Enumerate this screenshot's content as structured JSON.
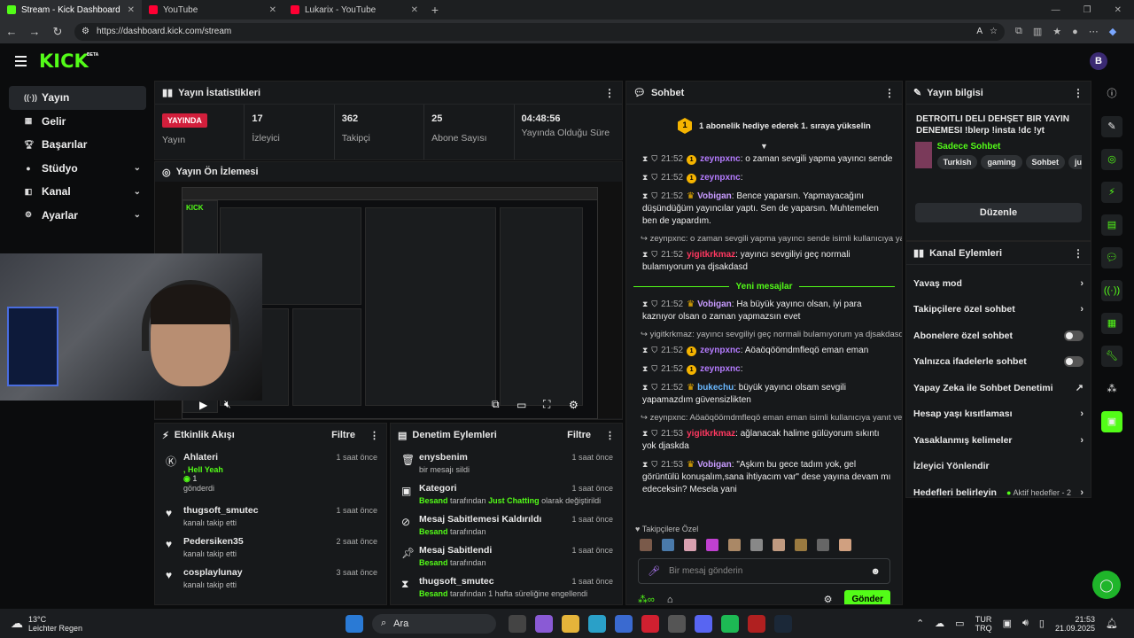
{
  "browser": {
    "tabs": [
      {
        "title": "Stream - Kick Dashboard",
        "color": "#53fc18"
      },
      {
        "title": "YouTube",
        "color": "#ff0033"
      },
      {
        "title": "Lukarix - YouTube",
        "color": "#ff0033"
      }
    ],
    "url": "https://dashboard.kick.com/stream"
  },
  "brand": {
    "logo": "KICK",
    "beta": "BETA",
    "accent": "#53fc18",
    "user_initial": "B"
  },
  "sidebar": {
    "items": [
      {
        "label": "Yayın",
        "icon": "broadcast-icon"
      },
      {
        "label": "Gelir",
        "icon": "chart-icon"
      },
      {
        "label": "Başarılar",
        "icon": "trophy-icon"
      },
      {
        "label": "Stüdyo",
        "icon": "studio-icon"
      },
      {
        "label": "Kanal",
        "icon": "channel-icon"
      },
      {
        "label": "Ayarlar",
        "icon": "gear-icon"
      }
    ]
  },
  "stats": {
    "title": "Yayın İstatistikleri",
    "live_badge": "YAYINDA",
    "live_label": "Yayın",
    "items": [
      {
        "value": "17",
        "label": "İzleyici"
      },
      {
        "value": "362",
        "label": "Takipçi"
      },
      {
        "value": "25",
        "label": "Abone Sayısı"
      },
      {
        "value": "04:48:56",
        "label": "Yayında Olduğu Süre"
      }
    ]
  },
  "preview": {
    "title": "Yayın Ön İzlemesi"
  },
  "activity": {
    "title": "Etkinlik Akışı",
    "filter": "Filtre",
    "items": [
      {
        "name": "Ahlateri",
        "line1": ", Hell Yeah",
        "line2": "1",
        "line3": "gönderdi",
        "time": "1 saat önce"
      },
      {
        "name": "thugsoft_smutec",
        "sub": "kanalı takip etti",
        "time": "1 saat önce"
      },
      {
        "name": "Pedersiken35",
        "sub": "kanalı takip etti",
        "time": "2 saat önce"
      },
      {
        "name": "cosplaylunay",
        "sub": "kanalı takip etti",
        "time": "3 saat önce"
      }
    ]
  },
  "moderation": {
    "title": "Denetim Eylemleri",
    "filter": "Filtre",
    "items": [
      {
        "name": "enysbenim",
        "sub": "bir mesajı sildi",
        "time": "1 saat önce"
      },
      {
        "name": "Kategori",
        "actor": "Besand",
        "mid": "tarafından",
        "target": "Just Chatting",
        "tail": "olarak değiştirildi",
        "time": "1 saat önce"
      },
      {
        "name": "Mesaj Sabitlemesi Kaldırıldı",
        "actor": "Besand",
        "mid": "tarafından",
        "time": "1 saat önce"
      },
      {
        "name": "Mesaj Sabitlendi",
        "actor": "Besand",
        "mid": "tarafından",
        "time": "1 saat önce"
      },
      {
        "name": "thugsoft_smutec",
        "actor": "Besand",
        "mid": "tarafından 1 hafta süreliğine engellendi",
        "time": "1 saat önce"
      }
    ]
  },
  "chat": {
    "title": "Sohbet",
    "gift_banner": "1 abonelik hediye ederek 1. sıraya yükselin",
    "gift_rank": "1",
    "new_messages": "Yeni mesajlar",
    "messages": [
      {
        "time": "21:52",
        "badge": "1",
        "user": "zeynpxnc",
        "ucolor": "#b57cff",
        "text": "o zaman sevgili yapma yayıncı sende"
      },
      {
        "time": "21:52",
        "badge": "1",
        "user": "zeynpxnc",
        "ucolor": "#b57cff",
        "text": ""
      },
      {
        "time": "21:52",
        "badge": "crown",
        "user": "Vobigan",
        "ucolor": "#c89bff",
        "text": "Bence yaparsın. Yapmayacağını düşündüğüm yayıncılar yaptı. Sen de yaparsın. Muhtemelen ben de yapardım."
      },
      {
        "reply": "zeynpxnc: o zaman sevgili yapma yayıncı sende isimli kullanıcıya yanı..."
      },
      {
        "time": "21:52",
        "badge": "none",
        "user": "yigitkrkmaz",
        "ucolor": "#ff3860",
        "text": "yayıncı sevgiliyi geç normali bulamıyorum ya djsakdasd"
      },
      {
        "divider": true
      },
      {
        "time": "21:52",
        "badge": "crown",
        "user": "Vobigan",
        "ucolor": "#c89bff",
        "text": "Ha büyük yayıncı olsan, iyi para kaznıyor olsan o zaman yapmazsın evet"
      },
      {
        "reply": "yigitkrkmaz: yayıncı sevgiliyi geç normali bulamıyorum ya djsakdasd i..."
      },
      {
        "time": "21:52",
        "badge": "1",
        "user": "zeynpxnc",
        "ucolor": "#b57cff",
        "text": "Aöaöqöömdmfleqö eman eman"
      },
      {
        "time": "21:52",
        "badge": "1",
        "user": "zeynpxnc",
        "ucolor": "#b57cff",
        "text": ""
      },
      {
        "time": "21:52",
        "badge": "crown",
        "user": "bukechu",
        "ucolor": "#6ab8ff",
        "text": "büyük yayıncı olsam sevgili yapamazdım güvensizlikten"
      },
      {
        "reply": "zeynpxnc: Aöaöqöömdmfleqö eman eman isimli kullanıcıya yanıt ver..."
      },
      {
        "time": "21:53",
        "badge": "none",
        "user": "yigitkrkmaz",
        "ucolor": "#ff3860",
        "text": "ağlanacak halime gülüyorum sıkıntı yok djaskda"
      },
      {
        "time": "21:53",
        "badge": "crown",
        "user": "Vobigan",
        "ucolor": "#c89bff",
        "text": "\"Aşkım bu gece tadım yok, gel görüntülü konuşalım,sana ihtiyacım var\" dese yayına devam mı edeceksin? Mesela yani"
      }
    ],
    "followers_label": "Takipçilere Özel",
    "input_placeholder": "Bir mesaj gönderin",
    "send": "Gönder"
  },
  "info": {
    "title": "Yayın bilgisi",
    "stream_title": "DETROITLI DELI DEHŞET BIR YAYIN DENEMESI !blerp !insta !dc !yt",
    "category": "Sadece Sohbet",
    "tags": [
      "Turkish",
      "gaming",
      "Sohbet",
      "justch"
    ],
    "edit": "Düzenle"
  },
  "actions": {
    "title": "Kanal Eylemleri",
    "items": [
      {
        "label": "Yavaş mod",
        "kind": "chevron"
      },
      {
        "label": "Takipçilere özel sohbet",
        "kind": "chevron"
      },
      {
        "label": "Abonelere özel sohbet",
        "kind": "toggle"
      },
      {
        "label": "Yalnızca ifadelerle sohbet",
        "kind": "toggle"
      },
      {
        "label": "Yapay Zeka ile Sohbet Denetimi",
        "kind": "external"
      },
      {
        "label": "Hesap yaşı kısıtlaması",
        "kind": "chevron"
      },
      {
        "label": "Yasaklanmış kelimeler",
        "kind": "chevron"
      },
      {
        "label": "İzleyici Yönlendir",
        "kind": "none"
      },
      {
        "label": "Hedefleri belirleyin",
        "kind": "chevron",
        "extra": "Aktif hedefler - 2"
      }
    ]
  },
  "taskbar": {
    "temp": "13°C",
    "weather": "Leichter Regen",
    "search": "Ara",
    "lang1": "TUR",
    "lang2": "TRQ",
    "time": "21:53",
    "date": "21.09.2025"
  }
}
